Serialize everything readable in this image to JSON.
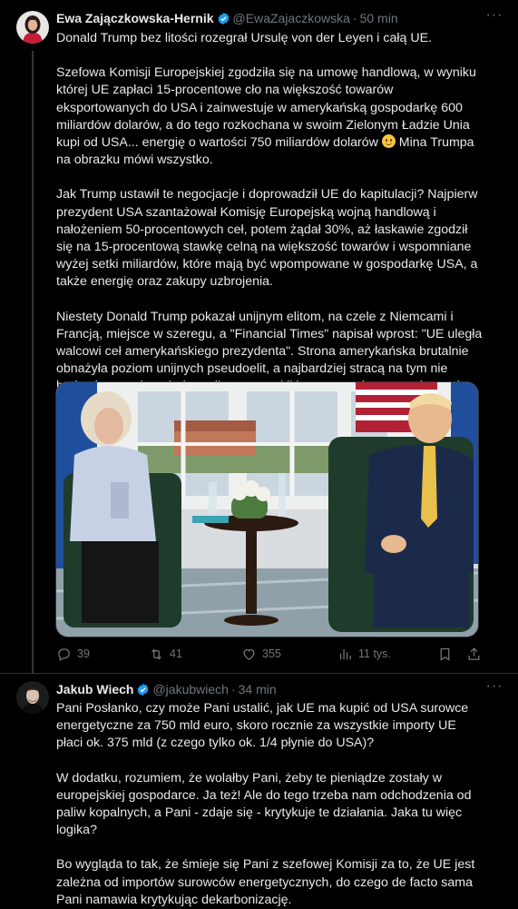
{
  "tweets": [
    {
      "author": {
        "name": "Ewa Zajączkowska-Hernik",
        "handle": "@EwaZajaczkowska",
        "time": "50 min",
        "verified": true
      },
      "paragraphs": [
        "Donald Trump bez litości rozegrał Ursulę von der Leyen i całą UE.",
        "Szefowa Komisji Europejskiej zgodziła się na umowę handlową, w wyniku której UE zapłaci 15-procentowe cło na większość towarów eksportowanych do USA i zainwestuje w amerykańską gospodarkę 600 miliardów dolarów, a do tego rozkochana w swoim Zielonym Ładzie Unia kupi od USA... energię o wartości 750 miliardów dolarów",
        "Mina Trumpa na obrazku mówi wszystko.",
        "Jak Trump ustawił te negocjacje i doprowadził UE do kapitulacji? Najpierw prezydent USA szantażował Komisję Europejską wojną handlową i nałożeniem 50-procentowych ceł, potem żądał 30%, aż łaskawie zgodził się na 15-procentową stawkę celną na większość towarów i wspomniane wyżej setki miliardów, które mają być wpompowane w gospodarkę USA, a także energię oraz zakupy uzbrojenia.",
        "Niestety Donald Trump pokazał unijnym elitom, na czele z Niemcami i Francją, miejsce w szeregu, a \"Financial Times\" napisał wprost: \"UE uległa walcowi ceł amerykańskiego prezydenta\". Strona amerykańska brutalnie obnażyła poziom unijnych pseudoelit, a najbardziej stracą na tym nie brukselscy możnowładcy, tylko my, zwykli konsumenci oraz producenci."
      ],
      "emoji": "slightly-smiling-face-emoji",
      "stats": {
        "replies": "39",
        "reposts": "41",
        "likes": "355",
        "views": "11 tys."
      }
    },
    {
      "author": {
        "name": "Jakub Wiech",
        "handle": "@jakubwiech",
        "time": "34 min",
        "verified": true
      },
      "paragraphs": [
        "Pani Posłanko, czy może Pani ustalić, jak UE ma kupić od USA surowce energetyczne za 750 mld euro, skoro rocznie za wszystkie importy UE płaci ok. 375 mld (z czego tylko ok. 1/4 płynie do USA)?",
        "W dodatku, rozumiem, że wolałby Pani, żeby te pieniądze zostały w europejskiej gospodarce. Ja też! Ale do tego trzeba nam odchodzenia od paliw kopalnych, a Pani - zdaje się - krytykuje te działania. Jaka tu więc logika?",
        "Bo wygląda to tak, że śmieje się Pani z szefowej Komisji za to, że UE jest zależna od importów surowców energetycznych, do czego de facto sama Pani namawia krytykując dekarbonizację."
      ]
    }
  ],
  "icons": {
    "more": "more-options-icon",
    "verified": "verified-badge-icon",
    "reply": "reply-icon",
    "repost": "repost-icon",
    "like": "like-icon",
    "views": "views-icon",
    "bookmark": "bookmark-icon",
    "share": "share-icon"
  },
  "colors": {
    "background": "#000000",
    "text": "#e7e9ea",
    "muted": "#71767b",
    "verified": "#1d9bf0",
    "border": "#2f3336"
  }
}
